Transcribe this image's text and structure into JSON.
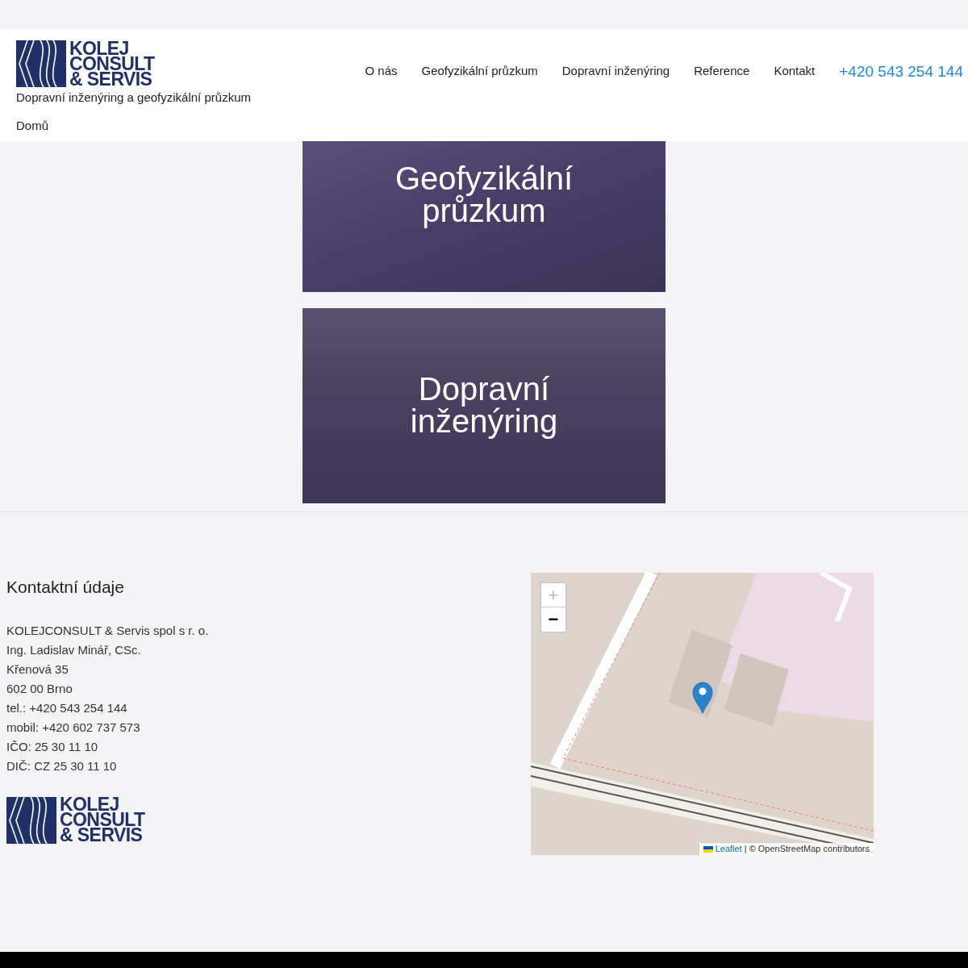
{
  "header": {
    "logo_lines": [
      "KOLEJ",
      "CONSULT",
      "& SERVIS"
    ],
    "tagline": "Dopravní inženýring a geofyzikální průzkum",
    "breadcrumb": "Domů",
    "nav": [
      {
        "label": "O nás",
        "kind": "link"
      },
      {
        "label": "Geofyzikální průzkum",
        "kind": "link"
      },
      {
        "label": "Dopravní inženýring",
        "kind": "link"
      },
      {
        "label": "Reference",
        "kind": "link"
      },
      {
        "label": "Kontakt",
        "kind": "link"
      },
      {
        "label": "+420 543 254 144",
        "kind": "phone"
      }
    ]
  },
  "cards": [
    {
      "title": "Geofyzikální průzkum",
      "kind": "rock"
    },
    {
      "title": "Dopravní inženýring",
      "kind": "rail"
    }
  ],
  "contact": {
    "heading": "Kontaktní údaje",
    "lines": [
      "KOLEJCONSULT & Servis spol s r. o.",
      "Ing. Ladislav Minář, CSc.",
      "Křenová 35",
      "602 00 Brno",
      "tel.: +420 543 254 144",
      "mobil: +420 602 737 573",
      "IČO: 25 30 11 10",
      "DIČ: CZ 25 30 11 10"
    ],
    "logo_lines": [
      "KOLEJ",
      "CONSULT",
      "& SERVIS"
    ]
  },
  "map": {
    "zoom_in": "+",
    "zoom_out": "−",
    "attribution_link": "Leaflet",
    "attribution_text": "| © OpenStreetMap contributors"
  }
}
